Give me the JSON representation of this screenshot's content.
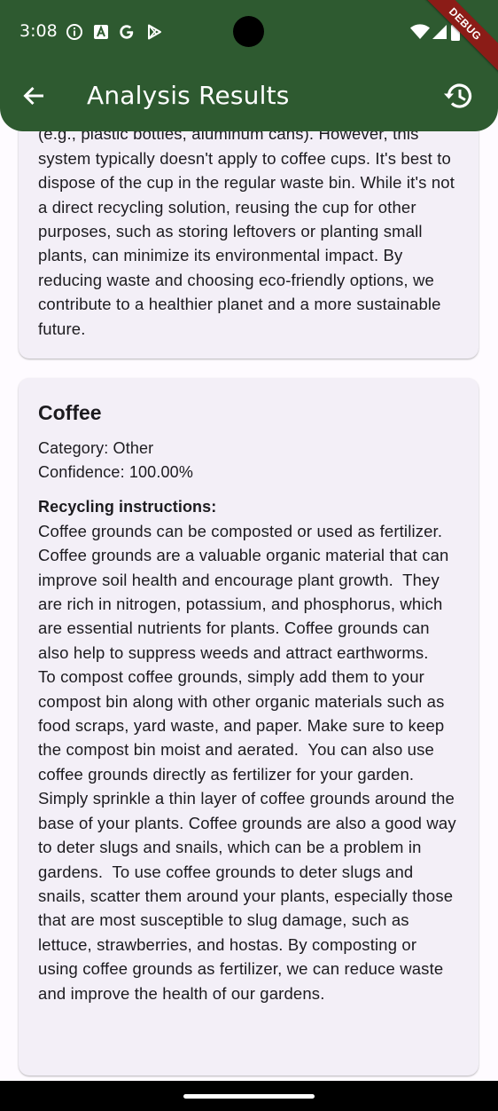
{
  "status_bar": {
    "time": "3:08",
    "icons": [
      "info-icon",
      "a-notification-icon",
      "google-icon",
      "play-store-icon",
      "wifi-icon",
      "signal-icon",
      "battery-icon"
    ]
  },
  "app_bar": {
    "title": "Analysis Results",
    "back_icon": "arrow-back-icon",
    "history_icon": "history-icon",
    "color": "#2e5a30"
  },
  "debug_banner": "DEBUG",
  "results": [
    {
      "partial_instructions": "(e.g., plastic bottles, aluminum cans). However, this system typically doesn't apply to coffee cups. It's best to dispose of the cup in the regular waste bin. While it's not a direct recycling solution, reusing the cup for other purposes, such as storing leftovers or planting small plants, can minimize its environmental impact. By reducing waste and choosing eco-friendly options, we contribute to a healthier planet and a more sustainable future."
    },
    {
      "name": "Coffee",
      "category": "Category: Other",
      "confidence": "Confidence: 100.00%",
      "instructions_label": "Recycling instructions:",
      "instructions": "Coffee grounds can be composted or used as fertilizer.  Coffee grounds are a valuable organic material that can improve soil health and encourage plant growth.  They are rich in nitrogen, potassium, and phosphorus, which are essential nutrients for plants. Coffee grounds can also help to suppress weeds and attract earthworms.   To compost coffee grounds, simply add them to your compost bin along with other organic materials such as food scraps, yard waste, and paper. Make sure to keep the compost bin moist and aerated.  You can also use coffee grounds directly as fertilizer for your garden. Simply sprinkle a thin layer of coffee grounds around the base of your plants. Coffee grounds are also a good way to deter slugs and snails, which can be a problem in gardens.  To use coffee grounds to deter slugs and snails, scatter them around your plants, especially those that are most susceptible to slug damage, such as lettuce, strawberries, and hostas. By composting or using coffee grounds as fertilizer, we can reduce waste and improve the health of our gardens."
    }
  ]
}
